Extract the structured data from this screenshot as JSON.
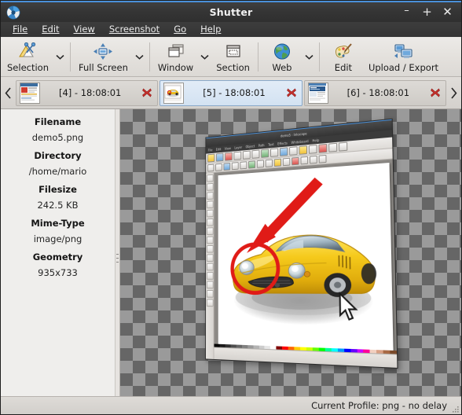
{
  "window": {
    "title": "Shutter",
    "app_icon": "shutter-aperture-icon",
    "controls": {
      "minimize": "–",
      "maximize": "+",
      "close": "✕"
    }
  },
  "menubar": {
    "items": [
      {
        "label": "File",
        "mnemonic": "F"
      },
      {
        "label": "Edit",
        "mnemonic": "E"
      },
      {
        "label": "View",
        "mnemonic": "V"
      },
      {
        "label": "Screenshot",
        "mnemonic": "S"
      },
      {
        "label": "Go",
        "mnemonic": "G"
      },
      {
        "label": "Help",
        "mnemonic": "H"
      }
    ]
  },
  "toolbar": {
    "items": [
      {
        "label": "Selection",
        "icon": "selection-icon",
        "has_dropdown": true
      },
      {
        "label": "Full Screen",
        "icon": "fullscreen-icon",
        "has_dropdown": true
      },
      {
        "label": "Window",
        "icon": "window-icon",
        "has_dropdown": true
      },
      {
        "label": "Section",
        "icon": "section-icon",
        "has_dropdown": false
      },
      {
        "label": "Web",
        "icon": "globe-icon",
        "has_dropdown": true
      },
      {
        "label": "Edit",
        "icon": "palette-brush-icon",
        "has_dropdown": false
      },
      {
        "label": "Upload / Export",
        "icon": "upload-export-icon",
        "has_dropdown": false
      }
    ]
  },
  "tabs": {
    "nav_prev_icon": "chevron-left-icon",
    "nav_next_icon": "chevron-right-icon",
    "close_icon": "close-x-icon",
    "items": [
      {
        "label": "[4] - 18:08:01",
        "active": false,
        "thumb": "webpage-thumbnail"
      },
      {
        "label": "[5] - 18:08:01",
        "active": true,
        "thumb": "car-image-thumbnail"
      },
      {
        "label": "[6] - 18:08:01",
        "active": false,
        "thumb": "document-thumbnail"
      }
    ]
  },
  "sidebar": {
    "properties": [
      {
        "key": "Filename",
        "value": "demo5.png"
      },
      {
        "key": "Directory",
        "value": "/home/mario"
      },
      {
        "key": "Filesize",
        "value": "242.5 KB"
      },
      {
        "key": "Mime-Type",
        "value": "image/png"
      },
      {
        "key": "Geometry",
        "value": "935x733"
      }
    ]
  },
  "canvas": {
    "background": "transparency-checkerboard",
    "screenshot": {
      "description": "perspective-rotated Inkscape window screenshot",
      "inner_app_title": "demo5 - Inkscape",
      "inner_menu": [
        "File",
        "Edit",
        "View",
        "Layer",
        "Object",
        "Path",
        "Text",
        "Effects",
        "Whiteboard",
        "Help"
      ],
      "annotations": [
        "red-arrow",
        "red-ellipse"
      ],
      "artwork": "yellow-sports-car"
    }
  },
  "statusbar": {
    "text": "Current Profile: png - no delay",
    "grip_icon": "resize-grip-icon"
  },
  "colors": {
    "titlebar": "#353535",
    "accent_blue": "#4a90d9",
    "toolbar_bg": "#e3e0dc",
    "active_tab": "#d3e2f2",
    "close_red": "#c9302c",
    "annotation_red": "#e01b17",
    "car_yellow": "#f2c319",
    "checker_dark": "#666666",
    "checker_light": "#9a9a9a"
  }
}
